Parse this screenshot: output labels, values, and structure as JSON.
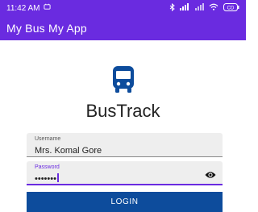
{
  "status_bar": {
    "time": "11:42 AM",
    "battery_label": "CD"
  },
  "app_bar": {
    "title": "My Bus My App"
  },
  "logo": {
    "icon": "bus-icon",
    "app_name": "BusTrack"
  },
  "form": {
    "username_label": "Username",
    "username_value": "Mrs. Komal Gore",
    "password_label": "Password",
    "password_value": "•••••••",
    "visibility_icon": "eye-icon"
  },
  "login_button": {
    "label": "LOGIN"
  },
  "colors": {
    "primary": "#6a2be0",
    "button": "#0d4c9c",
    "bus_icon": "#0d4c9c"
  }
}
